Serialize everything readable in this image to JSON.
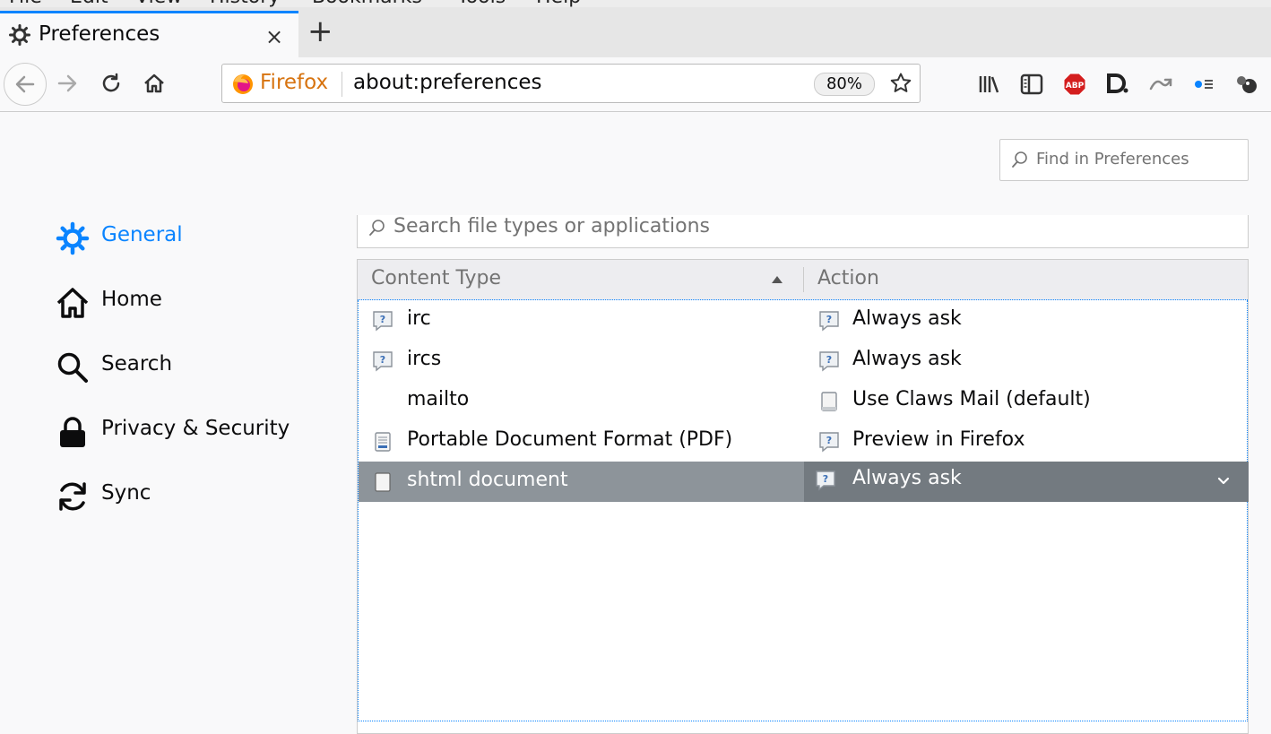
{
  "menubar": {
    "items": [
      "File",
      "Edit",
      "View",
      "History",
      "Bookmarks",
      "Tools",
      "Help"
    ]
  },
  "tab": {
    "title": "Preferences",
    "close_label": "×",
    "new_tab_label": "+"
  },
  "urlbar": {
    "identity": "Firefox",
    "url": "about:preferences",
    "zoom": "80%"
  },
  "toolbar_icons": [
    "library-icon",
    "sidebar-icon",
    "adblock-plus-icon",
    "disconnect-icon",
    "sync-tab-icon",
    "extension-icon",
    "extension2-icon"
  ],
  "find": {
    "placeholder": "Find in Preferences"
  },
  "sidebar": {
    "items": [
      {
        "label": "General",
        "icon": "gear-icon",
        "active": true
      },
      {
        "label": "Home",
        "icon": "home-icon"
      },
      {
        "label": "Search",
        "icon": "search-icon"
      },
      {
        "label": "Privacy & Security",
        "icon": "lock-icon"
      },
      {
        "label": "Sync",
        "icon": "sync-icon"
      }
    ]
  },
  "applications": {
    "search_placeholder": "Search file types or applications",
    "columns": [
      "Content Type",
      "Action"
    ],
    "rows": [
      {
        "type": "irc",
        "type_icon": "question-icon",
        "action": "Always ask",
        "action_icon": "question-icon"
      },
      {
        "type": "ircs",
        "type_icon": "question-icon",
        "action": "Always ask",
        "action_icon": "question-icon"
      },
      {
        "type": "mailto",
        "type_icon": "",
        "action": "Use Claws Mail (default)",
        "action_icon": "app-icon"
      },
      {
        "type": "Portable Document Format (PDF)",
        "type_icon": "pdf-icon",
        "action": "Preview in Firefox",
        "action_icon": "question-icon"
      },
      {
        "type": "shtml document",
        "type_icon": "document-icon",
        "action": "Always ask",
        "action_icon": "question-icon",
        "selected": true
      }
    ]
  },
  "colors": {
    "accent": "#0a84ff",
    "firefox_orange": "#d7730f",
    "selected_row": "#8d949a"
  }
}
